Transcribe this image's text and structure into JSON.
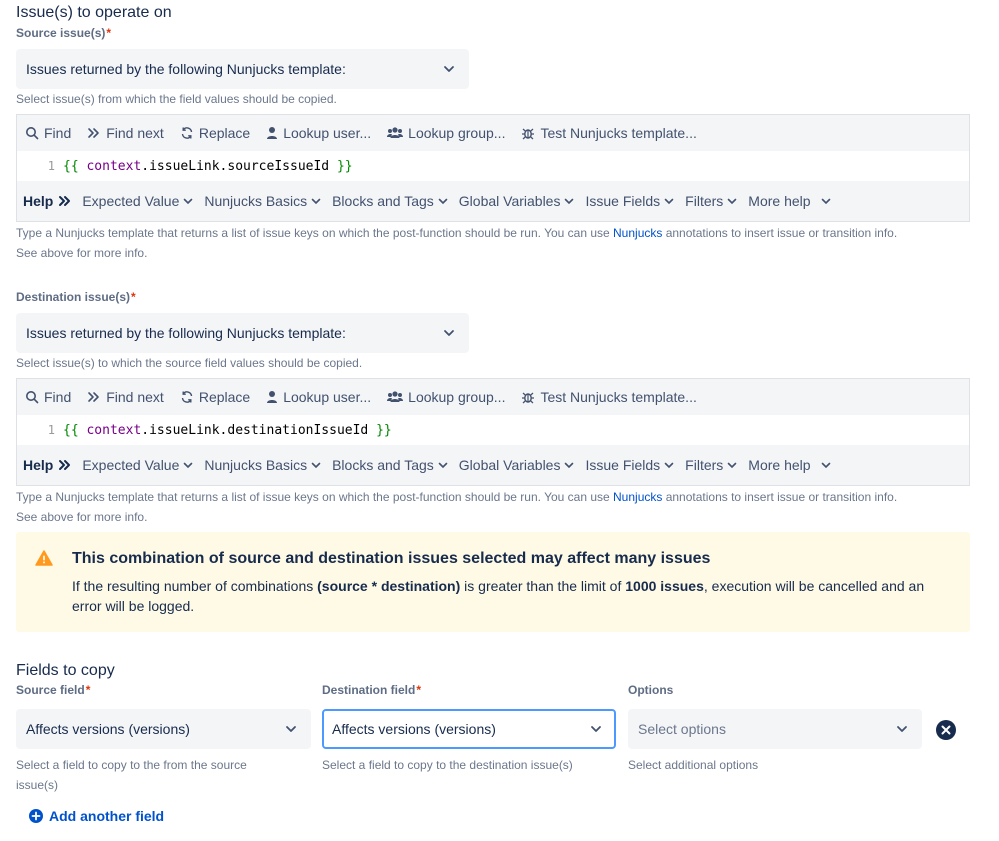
{
  "section1": {
    "title": "Issue(s) to operate on",
    "source_label": "Source issue(s)",
    "source_select": "Issues returned by the following Nunjucks template:",
    "source_help": "Select issue(s) from which the field values should be copied.",
    "source_code": {
      "line": "1",
      "open": "{{",
      "ctx": "context",
      "rest": ".issueLink.sourceIssueId",
      "close": "}}"
    },
    "dest_label": "Destination issue(s)",
    "dest_select": "Issues returned by the following Nunjucks template:",
    "dest_help": "Select issue(s) to which the source field values should be copied.",
    "dest_code": {
      "line": "1",
      "open": "{{",
      "ctx": "context",
      "rest": ".issueLink.destinationIssueId",
      "close": "}}"
    }
  },
  "toolbar": {
    "find": "Find",
    "find_next": "Find next",
    "replace": "Replace",
    "lookup_user": "Lookup user...",
    "lookup_group": "Lookup group...",
    "test": "Test Nunjucks template..."
  },
  "helpbar": {
    "help": "Help",
    "items": [
      "Expected Value",
      "Nunjucks Basics",
      "Blocks and Tags",
      "Global Variables",
      "Issue Fields",
      "Filters",
      "More help"
    ]
  },
  "template_help": {
    "before": "Type a Nunjucks template that returns a list of issue keys on which the post-function should be run. You can use ",
    "link": "Nunjucks",
    "after": " annotations to insert issue or transition info.",
    "line2": "See above for more info."
  },
  "warning": {
    "title": "This combination of source and destination issues selected may affect many issues",
    "body_1": "If the resulting number of combinations ",
    "body_bold_1": "(source * destination)",
    "body_2": " is greater than the limit of ",
    "body_bold_2": "1000 issues",
    "body_3": ", execution will be cancelled and an error will be logged."
  },
  "fields": {
    "title": "Fields to copy",
    "source_label": "Source field",
    "source_value": "Affects versions (versions)",
    "source_help": "Select a field to copy to the from the source issue(s)",
    "dest_label": "Destination field",
    "dest_value": "Affects versions (versions)",
    "dest_help": "Select a field to copy to the destination issue(s)",
    "options_label": "Options",
    "options_placeholder": "Select options",
    "options_help": "Select additional options",
    "add_link": "Add another field"
  },
  "colors": {
    "link": "#0052cc",
    "required": "#de350b",
    "warning_bg": "#fffae6",
    "warning_icon": "#ff991f",
    "focus": "#4c9aff"
  }
}
